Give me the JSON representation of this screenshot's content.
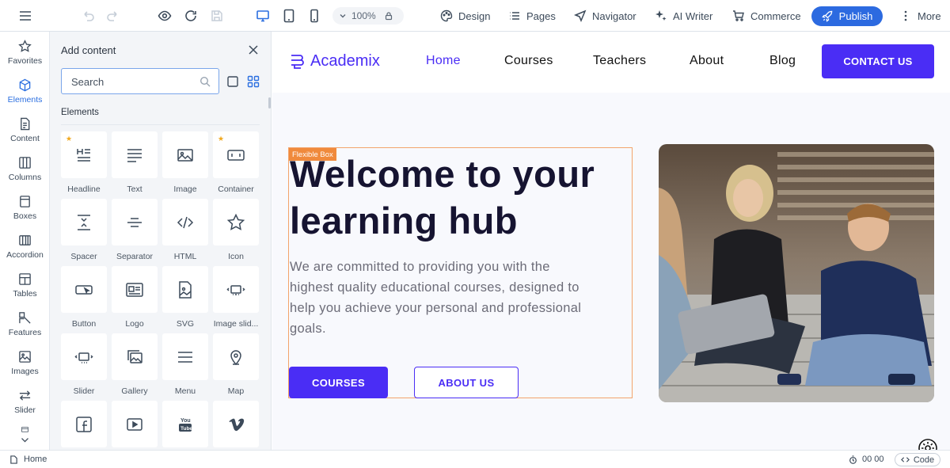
{
  "toolbar": {
    "zoom": "100%",
    "menu": {
      "design": "Design",
      "pages": "Pages",
      "navigator": "Navigator",
      "ai_writer": "AI Writer",
      "commerce": "Commerce",
      "publish": "Publish",
      "more": "More"
    }
  },
  "rail": [
    {
      "label": "Favorites",
      "icon": "star-icon"
    },
    {
      "label": "Elements",
      "icon": "cube-icon",
      "active": true
    },
    {
      "label": "Content",
      "icon": "document-icon"
    },
    {
      "label": "Columns",
      "icon": "columns-icon"
    },
    {
      "label": "Boxes",
      "icon": "box-icon"
    },
    {
      "label": "Accordion",
      "icon": "accordion-icon"
    },
    {
      "label": "Tables",
      "icon": "table-icon"
    },
    {
      "label": "Features",
      "icon": "features-icon"
    },
    {
      "label": "Images",
      "icon": "image-icon"
    },
    {
      "label": "Slider",
      "icon": "slider-arrows-icon"
    }
  ],
  "panel": {
    "title": "Add content",
    "search_placeholder": "Search",
    "section": "Elements",
    "tiles": [
      {
        "label": "Headline",
        "icon": "headline-icon",
        "favorite": true
      },
      {
        "label": "Text",
        "icon": "text-icon"
      },
      {
        "label": "Image",
        "icon": "image-icon"
      },
      {
        "label": "Container",
        "icon": "container-icon",
        "favorite": true
      },
      {
        "label": "Spacer",
        "icon": "spacer-icon"
      },
      {
        "label": "Separator",
        "icon": "separator-icon"
      },
      {
        "label": "HTML",
        "icon": "code-icon"
      },
      {
        "label": "Icon",
        "icon": "star-outline-icon"
      },
      {
        "label": "Button",
        "icon": "button-icon"
      },
      {
        "label": "Logo",
        "icon": "logo-icon"
      },
      {
        "label": "SVG",
        "icon": "svg-icon"
      },
      {
        "label": "Image slid...",
        "icon": "image-slider-icon"
      },
      {
        "label": "Slider",
        "icon": "slider-icon"
      },
      {
        "label": "Gallery",
        "icon": "gallery-icon"
      },
      {
        "label": "Menu",
        "icon": "menu-icon"
      },
      {
        "label": "Map",
        "icon": "map-pin-icon"
      },
      {
        "label": "",
        "icon": "facebook-icon"
      },
      {
        "label": "",
        "icon": "video-icon"
      },
      {
        "label": "",
        "icon": "youtube-icon"
      },
      {
        "label": "",
        "icon": "vimeo-icon"
      }
    ]
  },
  "site": {
    "logo": "Academix",
    "nav": [
      "Home",
      "Courses",
      "Teachers",
      "About",
      "Blog"
    ],
    "contact": "CONTACT US",
    "flex_tag": "Flexible Box",
    "hero_title": "Welcome to your learning hub",
    "hero_text": "We are committed to providing you with the highest quality educational courses, designed to help you achieve your personal and professional goals.",
    "btn_primary": "COURSES",
    "btn_outline": "ABOUT US",
    "accent_color": "#4a2df5"
  },
  "status": {
    "page": "Home",
    "time": "00 00",
    "code": "Code"
  }
}
